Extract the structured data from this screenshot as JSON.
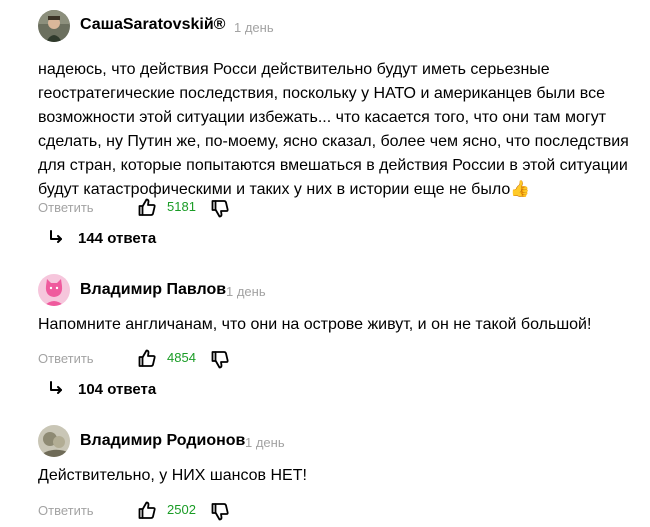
{
  "comments": [
    {
      "author": "СашаSaratovskiй®",
      "time": "1 день",
      "text": "надеюсь, что действия Росси действительно будут иметь серьезные геостратегические последствия, поскольку у НАТО и американцев были все возможности этой ситуации избежать... что касается того, что они там могут сделать, ну Путин же, по-моему, ясно сказал, более чем ясно, что последствия для стран, которые попытаются вмешаться в действия России в этой ситуации будут катастрофическими и таких у них в истории еще не было",
      "emoji": "👍",
      "reply_label": "Ответить",
      "likes": "5181",
      "replies_label": "144 ответа"
    },
    {
      "author": "Владимир Павлов",
      "time": "1 день",
      "text": "Напомните англичанам, что они на острове живут, и он не такой большой!",
      "reply_label": "Ответить",
      "likes": "4854",
      "replies_label": "104 ответа"
    },
    {
      "author": "Владимир Родионов",
      "time": "1 день",
      "text": "Действительно, у НИХ шансов НЕТ!",
      "reply_label": "Ответить",
      "likes": "2502"
    }
  ],
  "colors": {
    "likes": "#1a9c26",
    "muted": "#a3a3a3",
    "avatar_pink": "#f6c6dc",
    "avatar_cat": "#ef5a9d"
  },
  "icons": {
    "like": "thumbs-up-icon",
    "dislike": "thumbs-down-icon",
    "replies": "reply-arrow-icon"
  }
}
